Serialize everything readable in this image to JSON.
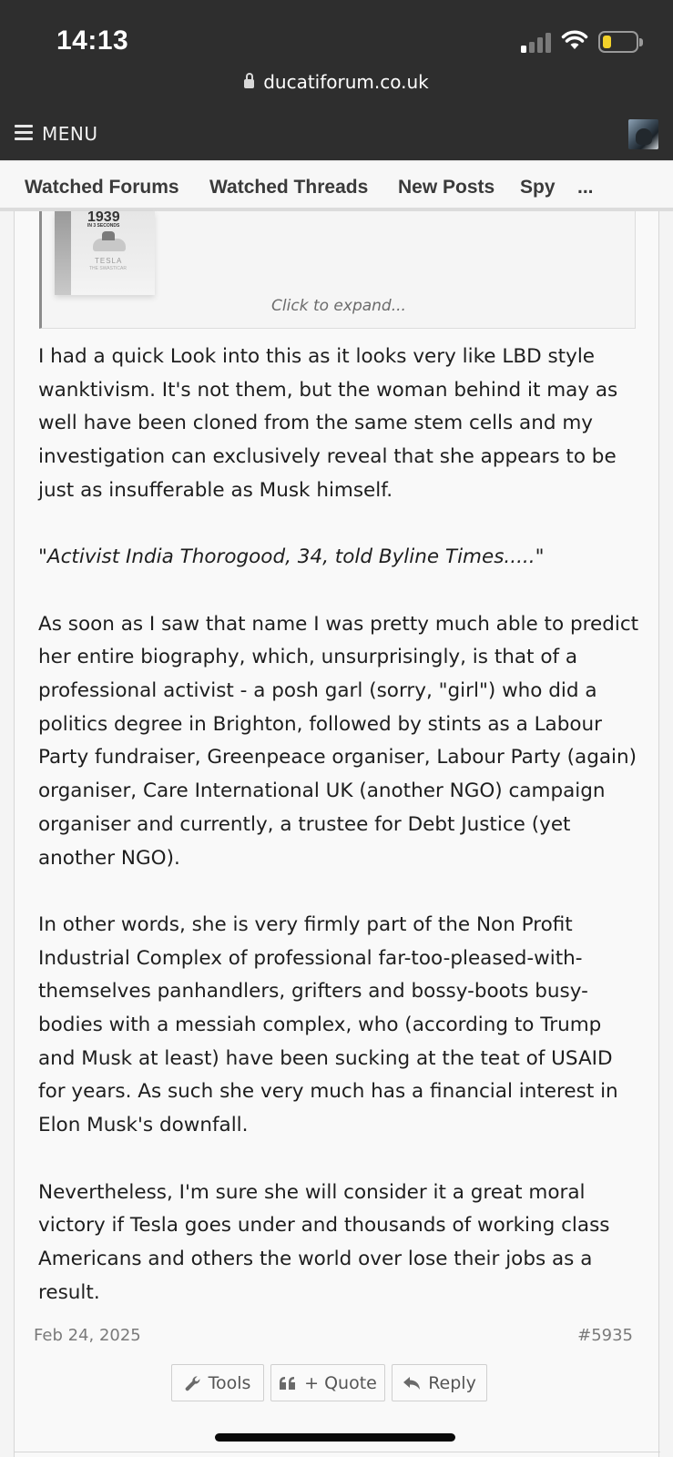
{
  "status": {
    "time": "14:13",
    "url": "ducatiforum.co.uk",
    "battery_color": "#f2d12a"
  },
  "menu": {
    "label": "MENU"
  },
  "tabs": [
    {
      "label": "Watched Forums"
    },
    {
      "label": "Watched Threads"
    },
    {
      "label": "New Posts"
    },
    {
      "label": "Spy"
    },
    {
      "label": "..."
    }
  ],
  "quote": {
    "thumb_text_big": "1939",
    "thumb_text_small": "IN 3 SECONDS",
    "thumb_brand": "TESLA",
    "thumb_brand_sub": "THE SWASTICAR",
    "expand_label": "Click to expand..."
  },
  "post": {
    "paragraphs": [
      "I had a quick Look into this as it looks very like LBD style wanktivism. It's not them, but the woman behind it may as well have been cloned from the same stem cells and my investigation can exclusively reveal that she appears to be just as insufferable as Musk himself.",
      "Activist India Thorogood, 34, told Byline Times.....",
      "As soon as I saw that name I was pretty much able to predict her entire biography, which, unsurprisingly, is that of a professional activist - a posh garl (sorry, \"girl\") who did a politics degree in Brighton, followed by stints as a Labour Party fundraiser, Greenpeace organiser, Labour Party (again) organiser, Care International UK (another NGO) campaign organiser and currently, a trustee for Debt Justice (yet another NGO).",
      "In other words, she is very firmly part of the Non Profit Industrial Complex of professional far-too-pleased-with-themselves panhandlers, grifters and bossy-boots busy-bodies with a messiah complex, who (according to Trump and Musk at least) have been sucking at the teat of USAID for years. As such she very much has a financial interest in Elon Musk's downfall.",
      "Nevertheless, I'm sure she will consider it a great moral victory if Tesla goes under and thousands of working class Americans and others the world over lose their jobs as a result."
    ],
    "date": "Feb 24, 2025",
    "number": "#5935"
  },
  "actions": {
    "tools": "Tools",
    "quote": "+ Quote",
    "reply": "Reply"
  },
  "icons": {
    "lock": "lock-icon",
    "tools": "wrench-icon",
    "quote": "quote-icon",
    "reply": "reply-icon"
  }
}
